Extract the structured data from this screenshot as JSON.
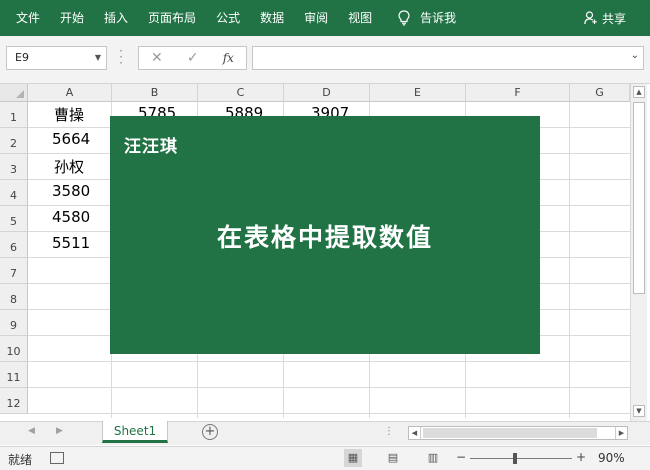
{
  "ribbon": {
    "tabs": [
      "文件",
      "开始",
      "插入",
      "页面布局",
      "公式",
      "数据",
      "审阅",
      "视图"
    ],
    "tell_me": "告诉我",
    "share": "共享",
    "colors": {
      "accent": "#217346"
    }
  },
  "formula_bar": {
    "name_box": "E9",
    "formula_value": "",
    "fx_label": "fx"
  },
  "sheet": {
    "columns": [
      "A",
      "B",
      "C",
      "D",
      "E",
      "F",
      "G"
    ],
    "rows": [
      "1",
      "2",
      "3",
      "4",
      "5",
      "6",
      "7",
      "8",
      "9",
      "10",
      "11",
      "12"
    ],
    "row1": {
      "a": "曹操",
      "b": "5785",
      "c": "5889",
      "d": "3907"
    },
    "colA": [
      "5664",
      "孙权",
      "3580",
      "4580",
      "5511"
    ]
  },
  "overlay": {
    "author": "汪汪琪",
    "headline": "在表格中提取数值"
  },
  "sheet_tabs": {
    "active": "Sheet1"
  },
  "status_bar": {
    "ready": "就绪",
    "zoom": "90%",
    "zoom_fraction": 0.9
  }
}
